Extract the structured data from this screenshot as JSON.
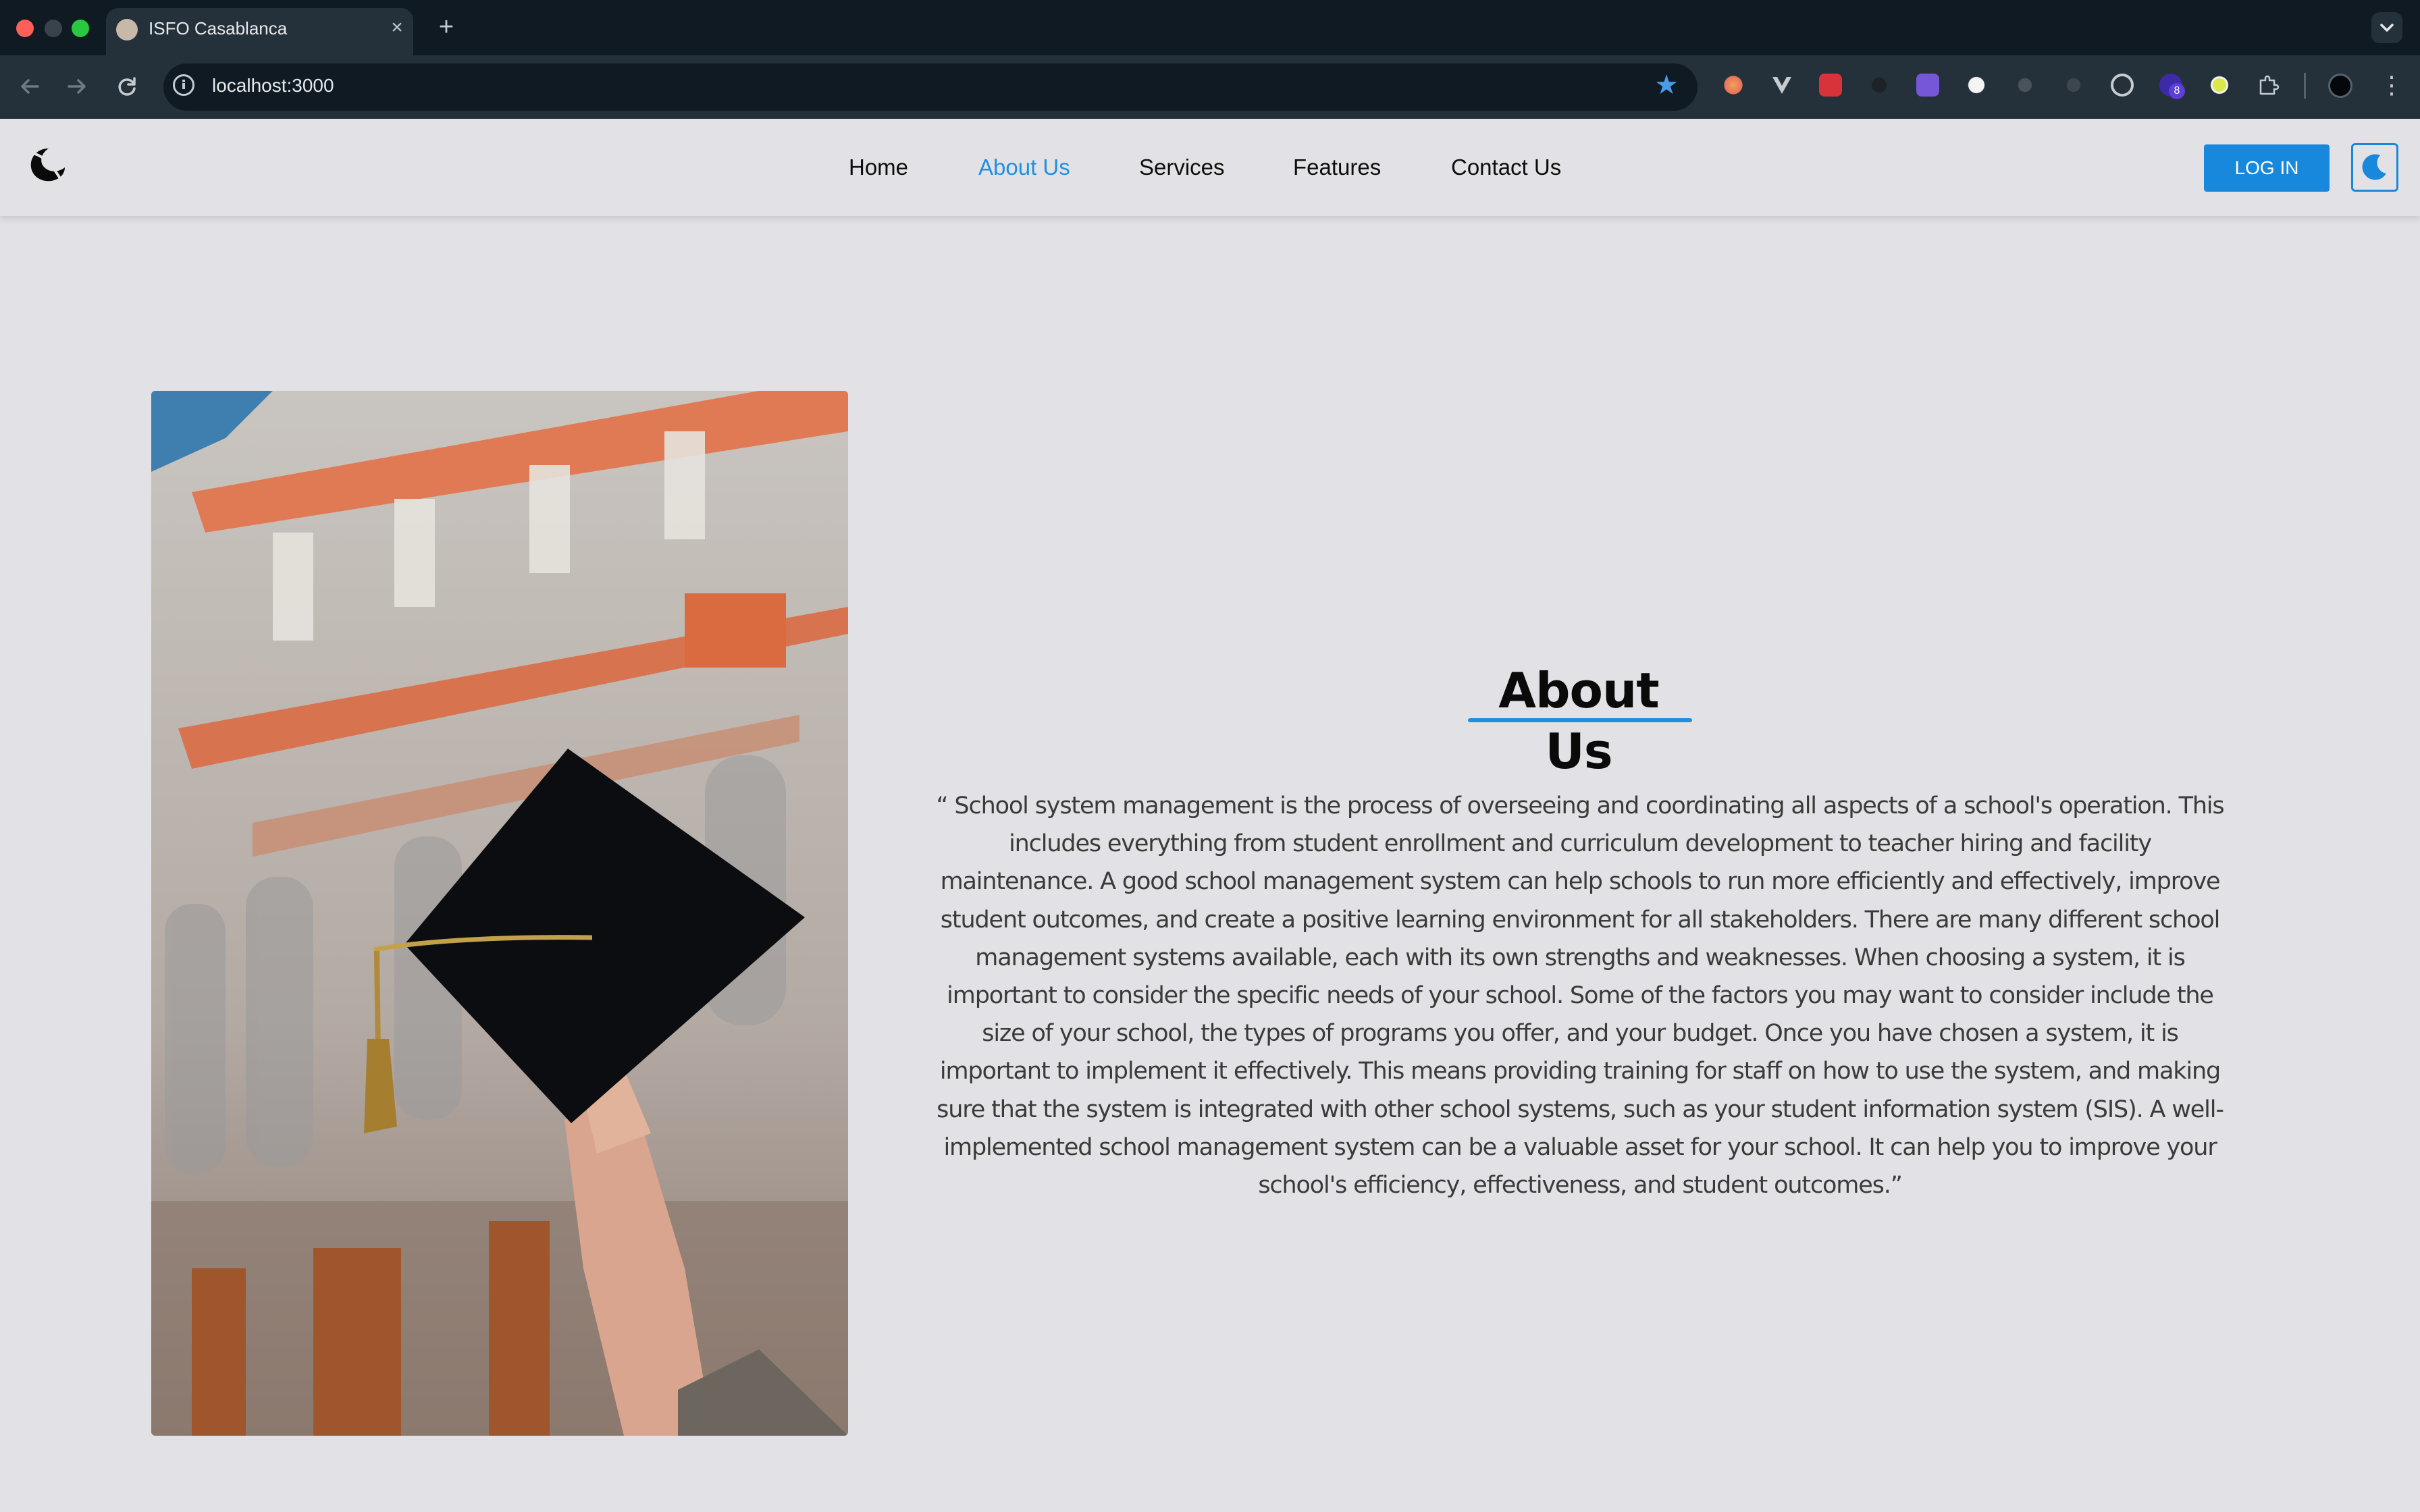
{
  "browser": {
    "tab_title": "ISFO Casablanca",
    "tab_close": "×",
    "new_tab": "+",
    "url": "localhost:3000",
    "star": "★",
    "menu": "⋮",
    "extension_badge": "8"
  },
  "navbar": {
    "links": [
      "Home",
      "About Us",
      "Services",
      "Features",
      "Contact Us"
    ],
    "active_link": "About Us",
    "login_label": "LOG IN",
    "accent_color": "#1f8fe0"
  },
  "about": {
    "title": "About Us",
    "paragraph": "“ School system management is the process of overseeing and coordinating all aspects of a school's operation. This includes everything from student enrollment and curriculum development to teacher hiring and facility maintenance. A good school management system can help schools to run more efficiently and effectively, improve student outcomes, and create a positive learning environment for all stakeholders. There are many different school management systems available, each with its own strengths and weaknesses. When choosing a system, it is important to consider the specific needs of your school. Some of the factors you may want to consider include the size of your school, the types of programs you offer, and your budget. Once you have chosen a system, it is important to implement it effectively. This means providing training for staff on how to use the system, and making sure that the system is integrated with other school systems, such as your student information system (SIS). A well-implemented school management system can be a valuable asset for your school. It can help you to improve your school's efficiency, effectiveness, and student outcomes.”"
  }
}
